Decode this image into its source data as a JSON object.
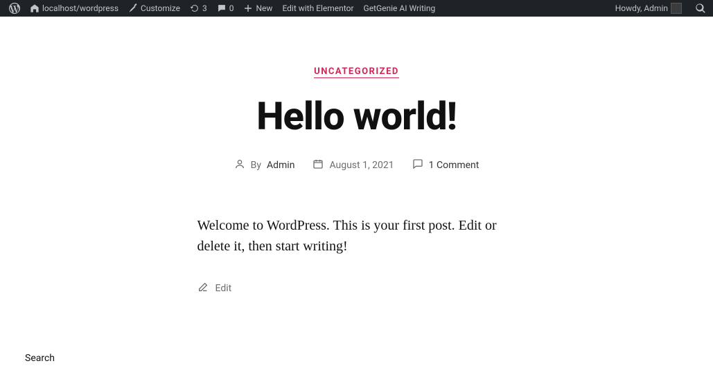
{
  "admin_bar": {
    "site_name": "localhost/wordpress",
    "customize": "Customize",
    "updates_count": "3",
    "comments_count": "0",
    "new_label": "New",
    "edit_elementor": "Edit with Elementor",
    "getgenie": "GetGenie AI Writing",
    "howdy": "Howdy, Admin"
  },
  "post": {
    "category": "UNCATEGORIZED",
    "title": "Hello world!",
    "by_label": "By ",
    "author": "Admin",
    "date": "August 1, 2021",
    "comments": "1 Comment",
    "body": "Welcome to WordPress. This is your first post. Edit or delete it, then start writing!",
    "edit_label": "Edit"
  },
  "footer": {
    "search_label": "Search"
  }
}
